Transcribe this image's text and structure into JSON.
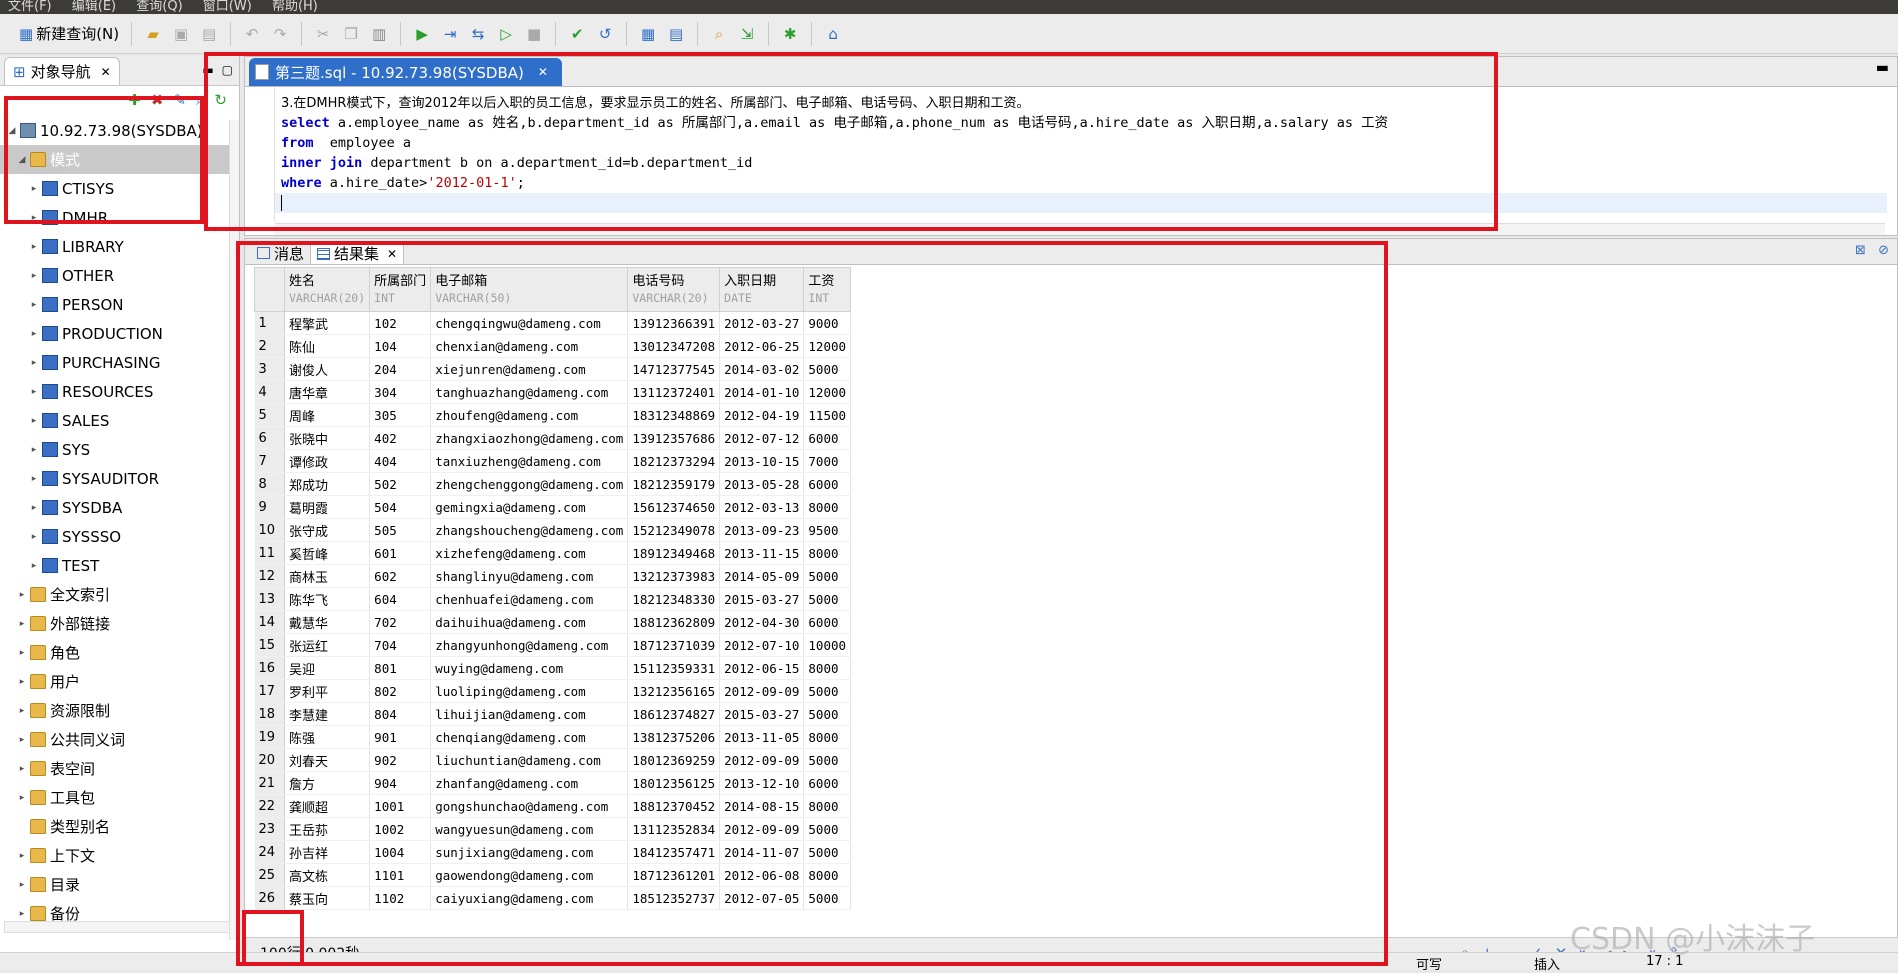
{
  "menu": [
    "文件(F)",
    "编辑(E)",
    "查询(Q)",
    "窗口(W)",
    "帮助(H)"
  ],
  "toolbar": {
    "new_query_label": "新建查询(N)"
  },
  "nav": {
    "tab_label": "对象导航",
    "root": "10.92.73.98(SYSDBA)",
    "schema_folder": "模式",
    "schemas": [
      "CTISYS",
      "DMHR",
      "LIBRARY",
      "OTHER",
      "PERSON",
      "PRODUCTION",
      "PURCHASING",
      "RESOURCES",
      "SALES",
      "SYS",
      "SYSAUDITOR",
      "SYSDBA",
      "SYSSSO",
      "TEST"
    ],
    "folders": [
      {
        "label": "全文索引",
        "arrow": true
      },
      {
        "label": "外部链接",
        "arrow": true
      },
      {
        "label": "角色",
        "arrow": true
      },
      {
        "label": "用户",
        "arrow": true
      },
      {
        "label": "资源限制",
        "arrow": true
      },
      {
        "label": "公共同义词",
        "arrow": true
      },
      {
        "label": "表空间",
        "arrow": true
      },
      {
        "label": "工具包",
        "arrow": true
      },
      {
        "label": "类型别名",
        "arrow": false
      },
      {
        "label": "上下文",
        "arrow": true
      },
      {
        "label": "目录",
        "arrow": true
      },
      {
        "label": "备份",
        "arrow": true
      }
    ]
  },
  "editor": {
    "tab_label": "第三题.sql - 10.92.73.98(SYSDBA)",
    "comment": "3.在DMHR模式下，查询2012年以后入职的员工信息，要求显示员工的姓名、所属部门、电子邮箱、电话号码、入职日期和工资。",
    "line2_kw": "select",
    "line2_rest": " a.employee_name as 姓名,b.department_id as 所属部门,a.email as 电子邮箱,a.phone_num as 电话号码,a.hire_date as 入职日期,a.salary as 工资",
    "line3_kw": "from",
    "line3_rest": "  employee a",
    "line4_kw": "inner join",
    "line4_rest": " department b on a.department_id=b.department_id",
    "line5_kw": "where",
    "line5_rest": " a.hire_date>",
    "line5_str": "'2012-01-1'",
    "line5_end": ";"
  },
  "results": {
    "tab_message": "消息",
    "tab_resultset": "结果集",
    "columns": [
      {
        "name": "姓名",
        "type": "VARCHAR(20)"
      },
      {
        "name": "所属部门",
        "type": "INT"
      },
      {
        "name": "电子邮箱",
        "type": "VARCHAR(50)"
      },
      {
        "name": "电话号码",
        "type": "VARCHAR(20)"
      },
      {
        "name": "入职日期",
        "type": "DATE"
      },
      {
        "name": "工资",
        "type": "INT"
      }
    ],
    "rows": [
      [
        "1",
        "程擎武",
        "102",
        "chengqingwu@dameng.com",
        "13912366391",
        "2012-03-27",
        "9000"
      ],
      [
        "2",
        "陈仙",
        "104",
        "chenxian@dameng.com",
        "13012347208",
        "2012-06-25",
        "12000"
      ],
      [
        "3",
        "谢俊人",
        "204",
        "xiejunren@dameng.com",
        "14712377545",
        "2014-03-02",
        "5000"
      ],
      [
        "4",
        "唐华章",
        "304",
        "tanghuazhang@dameng.com",
        "13112372401",
        "2014-01-10",
        "12000"
      ],
      [
        "5",
        "周峰",
        "305",
        "zhoufeng@dameng.com",
        "18312348869",
        "2012-04-19",
        "11500"
      ],
      [
        "6",
        "张晓中",
        "402",
        "zhangxiaozhong@dameng.com",
        "13912357686",
        "2012-07-12",
        "6000"
      ],
      [
        "7",
        "谭修政",
        "404",
        "tanxiuzheng@dameng.com",
        "18212373294",
        "2013-10-15",
        "7000"
      ],
      [
        "8",
        "郑成功",
        "502",
        "zhengchenggong@dameng.com",
        "18212359179",
        "2013-05-28",
        "6000"
      ],
      [
        "9",
        "葛明霞",
        "504",
        "gemingxia@dameng.com",
        "15612374650",
        "2012-03-13",
        "8000"
      ],
      [
        "10",
        "张守成",
        "505",
        "zhangshoucheng@dameng.com",
        "15212349078",
        "2013-09-23",
        "9500"
      ],
      [
        "11",
        "奚哲峰",
        "601",
        "xizhefeng@dameng.com",
        "18912349468",
        "2013-11-15",
        "8000"
      ],
      [
        "12",
        "商林玉",
        "602",
        "shanglinyu@dameng.com",
        "13212373983",
        "2014-05-09",
        "5000"
      ],
      [
        "13",
        "陈华飞",
        "604",
        "chenhuafei@dameng.com",
        "18212348330",
        "2015-03-27",
        "5000"
      ],
      [
        "14",
        "戴慧华",
        "702",
        "daihuihua@dameng.com",
        "18812362809",
        "2012-04-30",
        "6000"
      ],
      [
        "15",
        "张运红",
        "704",
        "zhangyunhong@dameng.com",
        "18712371039",
        "2012-07-10",
        "10000"
      ],
      [
        "16",
        "吴迎",
        "801",
        "wuying@dameng.com",
        "15112359331",
        "2012-06-15",
        "8000"
      ],
      [
        "17",
        "罗利平",
        "802",
        "luoliping@dameng.com",
        "13212356165",
        "2012-09-09",
        "5000"
      ],
      [
        "18",
        "李慧建",
        "804",
        "lihuijian@dameng.com",
        "18612374827",
        "2015-03-27",
        "5000"
      ],
      [
        "19",
        "陈强",
        "901",
        "chenqiang@dameng.com",
        "13812375206",
        "2013-11-05",
        "8000"
      ],
      [
        "20",
        "刘春天",
        "902",
        "liuchuntian@dameng.com",
        "18012369259",
        "2012-09-09",
        "5000"
      ],
      [
        "21",
        "詹方",
        "904",
        "zhanfang@dameng.com",
        "18012356125",
        "2013-12-10",
        "6000"
      ],
      [
        "22",
        "龚顺超",
        "1001",
        "gongshunchao@dameng.com",
        "18812370452",
        "2014-08-15",
        "8000"
      ],
      [
        "23",
        "王岳荪",
        "1002",
        "wangyuesun@dameng.com",
        "13112352834",
        "2012-09-09",
        "5000"
      ],
      [
        "24",
        "孙吉祥",
        "1004",
        "sunjixiang@dameng.com",
        "18412357471",
        "2014-11-07",
        "5000"
      ],
      [
        "25",
        "高文栋",
        "1101",
        "gaowendong@dameng.com",
        "18712361201",
        "2012-06-08",
        "8000"
      ],
      [
        "26",
        "蔡玉向",
        "1102",
        "caiyuxiang@dameng.com",
        "18512352737",
        "2012-07-05",
        "5000"
      ]
    ],
    "status": "100行,0.002秒"
  },
  "statusbar": {
    "writable": "可写",
    "insert": "插入",
    "position": "17 : 1"
  },
  "watermark": "CSDN @小沫沫子",
  "colors": {
    "annotation_red": "#e0141e",
    "tab_blue": "#2f6fc9",
    "keyword_blue": "#0000cc",
    "string_red": "#c00000"
  }
}
